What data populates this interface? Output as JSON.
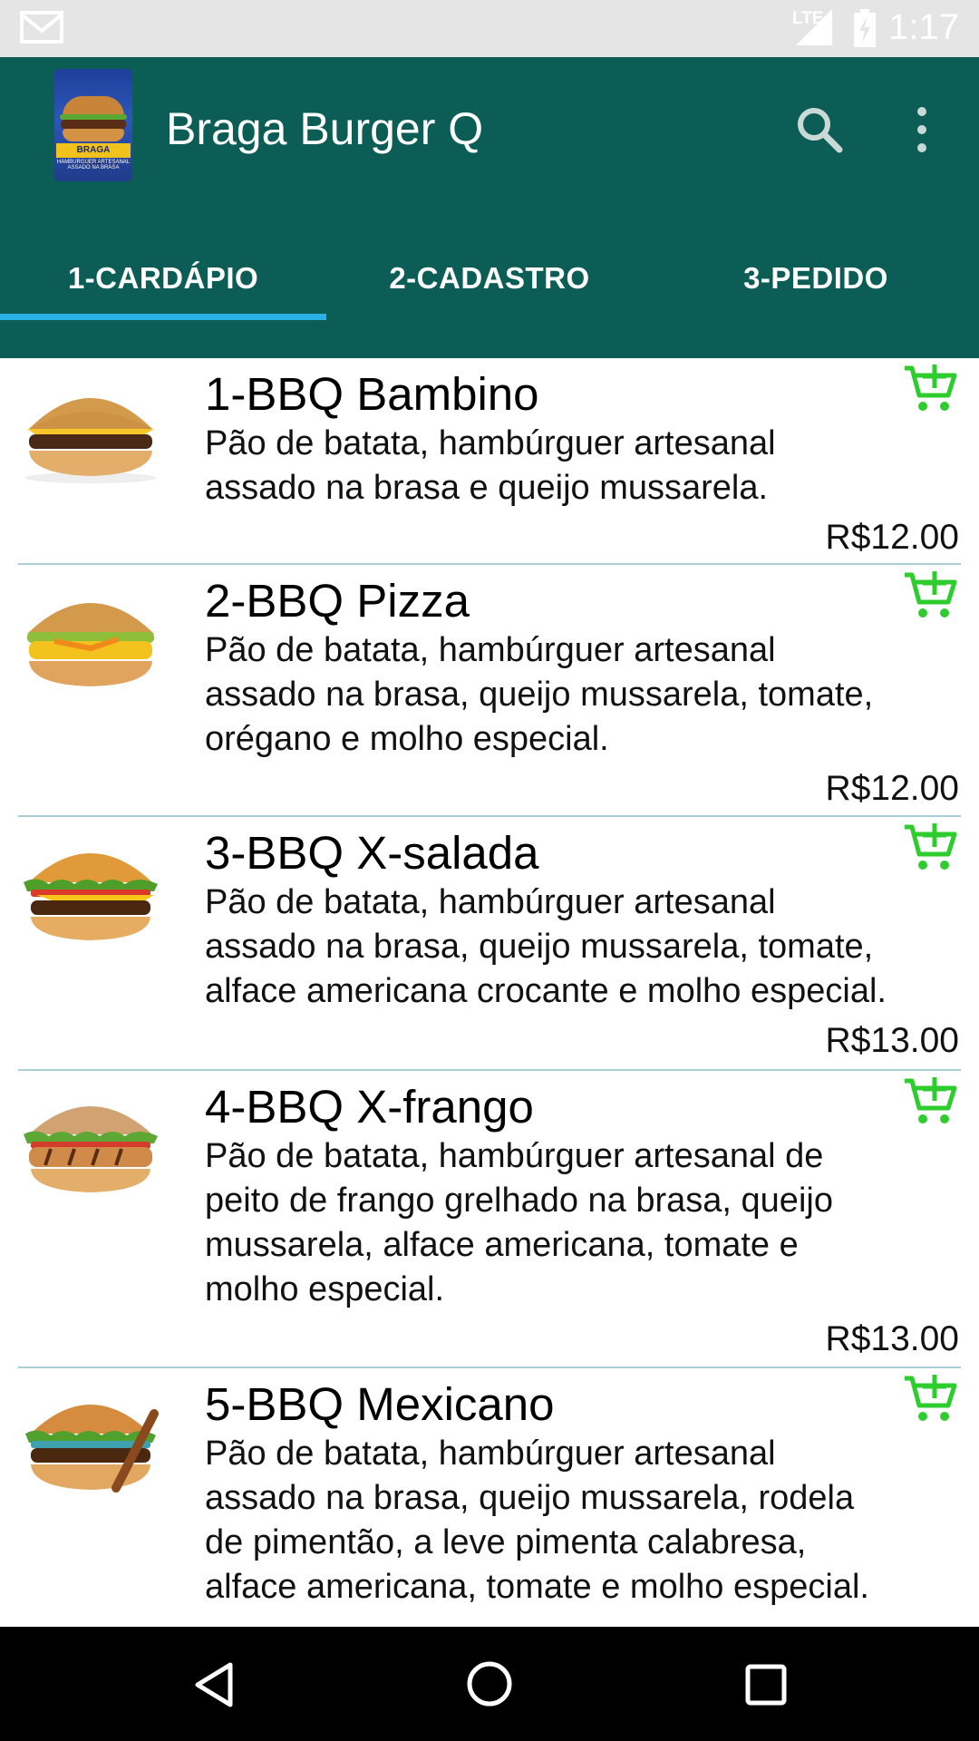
{
  "status_bar": {
    "network": "LTE",
    "time": "1:17",
    "icons": [
      "gmail-icon",
      "lte-signal-icon",
      "battery-charging-icon"
    ]
  },
  "app_bar": {
    "title": "Braga Burger Q",
    "logo_text": "BRAGA BURGER Q",
    "logo_tag": "HAMBURGUER ARTESANAL ASSADO NA BRASA",
    "actions": [
      "search-icon",
      "more-vert-icon"
    ]
  },
  "tabs": [
    {
      "label": "1-CARDÁPIO",
      "selected": true
    },
    {
      "label": "2-CADASTRO",
      "selected": false
    },
    {
      "label": "3-PEDIDO",
      "selected": false
    }
  ],
  "menu_items": [
    {
      "name": "1-BBQ Bambino",
      "desc_lines": [
        "Pão de batata, hambúrguer artesanal",
        "assado na brasa e queijo mussarela."
      ],
      "price": "R$12.00"
    },
    {
      "name": "2-BBQ Pizza",
      "desc_lines": [
        "Pão de batata, hambúrguer artesanal",
        "assado na brasa, queijo mussarela, tomate,",
        "orégano e molho especial."
      ],
      "price": "R$12.00"
    },
    {
      "name": "3-BBQ X-salada",
      "desc_lines": [
        "Pão de batata, hambúrguer artesanal",
        "assado na brasa, queijo mussarela, tomate,",
        "alface americana crocante e molho especial."
      ],
      "price": "R$13.00"
    },
    {
      "name": "4-BBQ X-frango",
      "desc_lines": [
        "Pão de batata, hambúrguer artesanal de",
        "peito de frango grelhado na brasa, queijo",
        "mussarela, alface americana, tomate e",
        "molho especial."
      ],
      "price": "R$13.00"
    },
    {
      "name": "5-BBQ Mexicano",
      "desc_lines": [
        "Pão de batata, hambúrguer artesanal",
        "assado na brasa, queijo mussarela, rodela",
        "de pimentão, a leve pimenta calabresa,",
        "alface americana, tomate e molho especial."
      ],
      "price": ""
    }
  ],
  "colors": {
    "app_bar": "#0b5d55",
    "tab_indicator": "#29b0e6",
    "cart_icon": "#2ecc2e",
    "divider": "#a9cfd6"
  },
  "nav_bar": {
    "buttons": [
      "back-icon",
      "home-icon",
      "recent-apps-icon"
    ]
  }
}
